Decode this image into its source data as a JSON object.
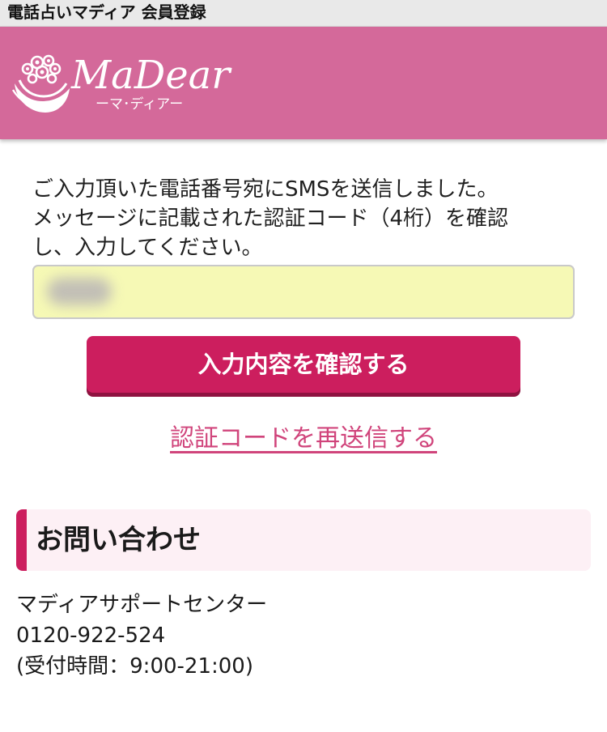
{
  "window": {
    "title": "電話占いマディア 会員登録"
  },
  "brand": {
    "logo_text": "MaDear",
    "logo_subtext": "ーマ･ディアー",
    "header_color": "#d4699a",
    "accent_color": "#cc1e5e",
    "logo_icon": "flower-hand-icon"
  },
  "instructions": {
    "lines": [
      "ご入力頂いた電話番号宛にSMSを送信しました。",
      "メッセージに記載された認証コード（4桁）を確認",
      "し、入力してください。"
    ]
  },
  "code_input": {
    "value": "",
    "placeholder": ""
  },
  "confirm_button": {
    "label": "入力内容を確認する"
  },
  "resend_link": {
    "label": "認証コードを再送信する"
  },
  "contact": {
    "title": "お問い合わせ",
    "center_name": "マディアサポートセンター",
    "phone": "0120-922-524",
    "hours": "(受付時間：9:00-21:00)"
  }
}
